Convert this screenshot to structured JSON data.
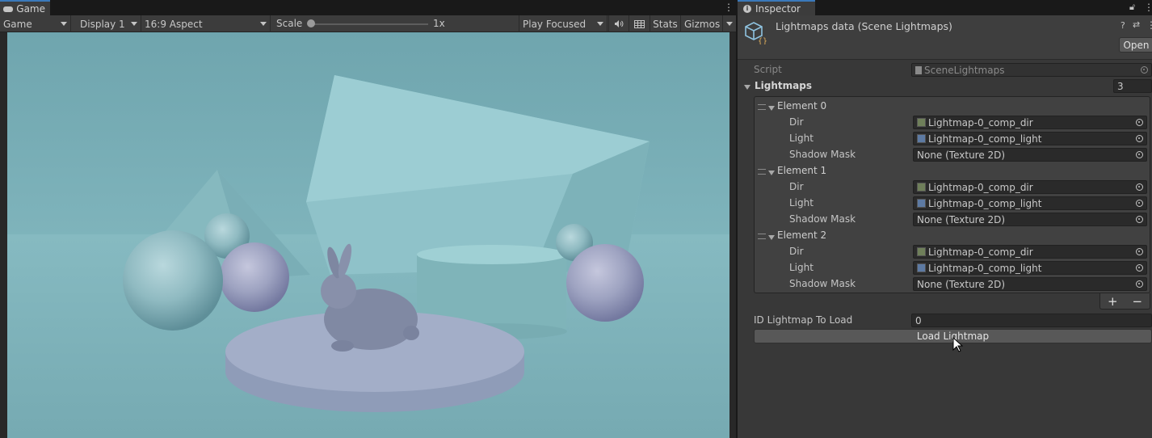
{
  "game": {
    "tab_label": "Game",
    "menu_icon": "kebab-menu-icon",
    "toolbar": {
      "view_mode": "Game",
      "display": "Display 1",
      "aspect": "16:9 Aspect",
      "scale_label": "Scale",
      "scale_value": "1x",
      "scale_fraction": 0.0,
      "play_mode": "Play Focused",
      "audio_icon": "speaker-icon",
      "stats_label": "Stats",
      "gizmos_label": "Gizmos"
    }
  },
  "inspector": {
    "tab_label": "Inspector",
    "title": "Lightmaps data (Scene Lightmaps)",
    "open_label": "Open",
    "script_label": "Script",
    "script_value": "SceneLightmaps",
    "list_label": "Lightmaps",
    "list_count": "3",
    "elements": [
      {
        "label": "Element 0",
        "dir_label": "Dir",
        "dir_value": "Lightmap-0_comp_dir",
        "light_label": "Light",
        "light_value": "Lightmap-0_comp_light",
        "shadow_label": "Shadow Mask",
        "shadow_value": "None (Texture 2D)"
      },
      {
        "label": "Element 1",
        "dir_label": "Dir",
        "dir_value": "Lightmap-0_comp_dir",
        "light_label": "Light",
        "light_value": "Lightmap-0_comp_light",
        "shadow_label": "Shadow Mask",
        "shadow_value": "None (Texture 2D)"
      },
      {
        "label": "Element 2",
        "dir_label": "Dir",
        "dir_value": "Lightmap-0_comp_dir",
        "light_label": "Light",
        "light_value": "Lightmap-0_comp_light",
        "shadow_label": "Shadow Mask",
        "shadow_value": "None (Texture 2D)"
      }
    ],
    "add_label": "+",
    "remove_label": "−",
    "id_label": "ID Lightmap To Load",
    "id_value": "0",
    "load_label": "Load Lightmap"
  },
  "colors": {
    "accent": "#3a79bb",
    "panel": "#383838",
    "field": "#2a2a2a",
    "scene_bg": "#7db2ba"
  }
}
